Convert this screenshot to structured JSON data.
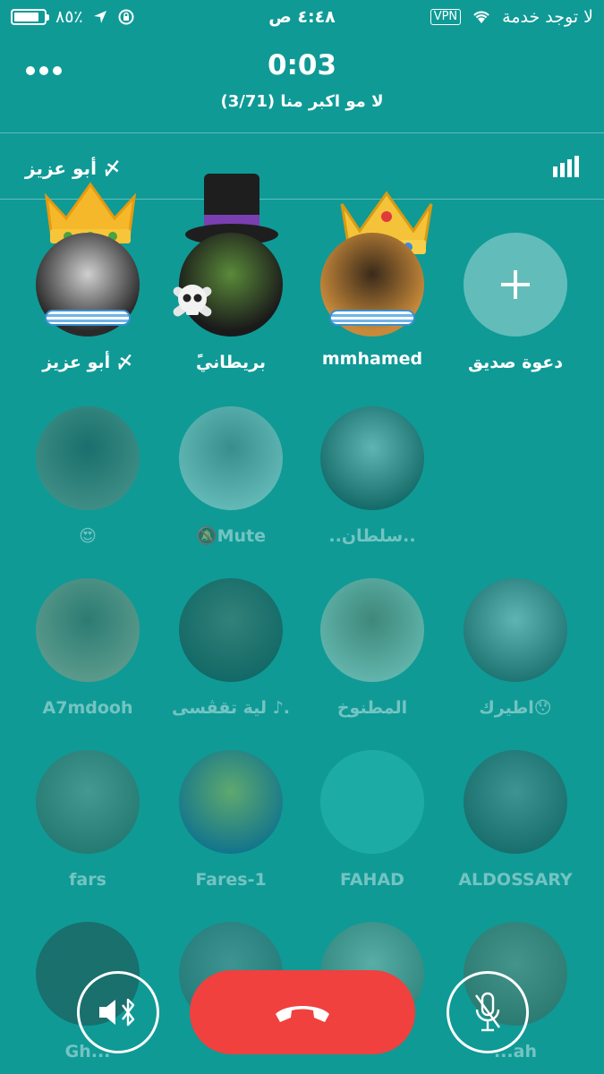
{
  "status_bar": {
    "battery_text": "٨٥٪",
    "battery_level": 0.85,
    "time": "٤:٤٨ ص",
    "vpn_label": "VPN",
    "carrier": "لا توجد خدمة"
  },
  "call": {
    "timer": "0:03",
    "room_title": "لا مو اكبر منا (3/71)",
    "current_speaker": "أﺑﻮ ﻋﺰﻳﺰ 〆"
  },
  "participants_active": [
    {
      "name": "أﺑﻮ ﻋﺰﻳﺰ 〆",
      "badge": "crown-gold",
      "colors": [
        "#2a2a2a",
        "#cfcfcf"
      ]
    },
    {
      "name": "ًبريطاني",
      "badge": "top-hat",
      "colors": [
        "#1a1a1a",
        "#5a8a3a"
      ]
    },
    {
      "name": "mmhamed",
      "badge": "crown-jeweled",
      "colors": [
        "#c88a3a",
        "#3a2a1a"
      ]
    },
    {
      "name": "دعوة صديق",
      "badge": "invite"
    }
  ],
  "participants_dimmed": [
    {
      "name": "😍",
      "colors": [
        "#8a7a6a",
        "#2a2a2a"
      ]
    },
    {
      "name": "🔕Mute",
      "colors": [
        "#eaeaea",
        "#7a7a7a"
      ]
    },
    {
      "name": "..سلطان..",
      "colors": [
        "#202020",
        "#e0e0e0"
      ]
    },
    {
      "name": "",
      "colors": null
    },
    {
      "name": "A7mdooh",
      "colors": [
        "#d49a7a",
        "#5a4a3a"
      ]
    },
    {
      "name": "لية تقڨسى ♪.",
      "colors": [
        "#1a1a1a",
        "#6a5a4a"
      ]
    },
    {
      "name": "المطنوخ",
      "colors": [
        "#e8e0d0",
        "#8a6a4a"
      ]
    },
    {
      "name": "اطيرك😯",
      "colors": [
        "#3a3a3a",
        "#e0e0e0"
      ]
    },
    {
      "name": "fars",
      "colors": [
        "#4a4a3a",
        "#9a9a8a"
      ]
    },
    {
      "name": "Fares-1",
      "colors": [
        "#1a3a7a",
        "#e0c030"
      ]
    },
    {
      "name": "FAHAD",
      "colors": [
        "#34c7c0",
        "#34c7c0"
      ]
    },
    {
      "name": "ALDOSSARY",
      "colors": [
        "#2a2a2a",
        "#8a8a8a"
      ]
    },
    {
      "name": "Gh...",
      "colors": [
        "#2a2a2a",
        "#2a2a2a"
      ]
    },
    {
      "name": "",
      "colors": [
        "#4a4a4a",
        "#8a8a8a"
      ]
    },
    {
      "name": "",
      "colors": [
        "#6a6a5a",
        "#cfcfbf"
      ]
    },
    {
      "name": "...ah",
      "colors": [
        "#5a4a3a",
        "#9a8a7a"
      ]
    }
  ],
  "controls": {
    "speaker_icon": "speaker-bluetooth-icon",
    "end_icon": "hang-up-icon",
    "mute_icon": "mic-off-icon",
    "end_color": "#f0413e"
  },
  "theme": {
    "background": "#0f9a96"
  }
}
